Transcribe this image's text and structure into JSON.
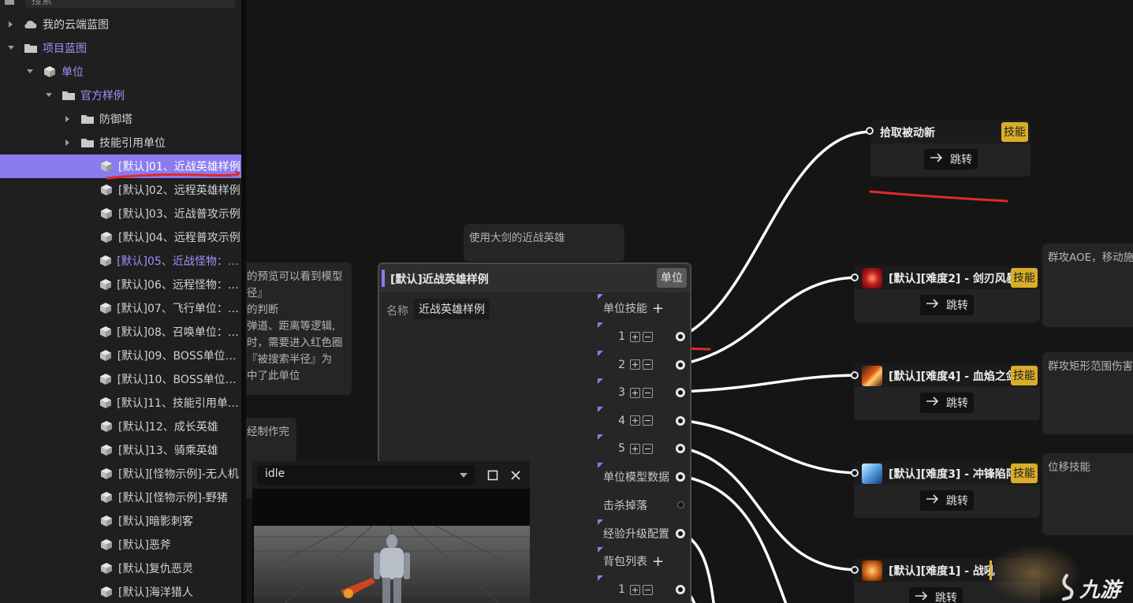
{
  "search": {
    "placeholder": "搜索"
  },
  "tree": {
    "items": [
      {
        "label": "我的云端蓝图",
        "icon": "cloud-icon",
        "expand": "collapsed"
      },
      {
        "label": "项目蓝图",
        "icon": "folder-icon",
        "expand": "expanded"
      },
      {
        "label": "单位",
        "icon": "cube-icon",
        "expand": "expanded"
      },
      {
        "label": "官方样例",
        "icon": "folder-icon",
        "expand": "expanded"
      },
      {
        "label": "防御塔",
        "icon": "folder-icon",
        "expand": "collapsed"
      },
      {
        "label": "技能引用单位",
        "icon": "folder-icon",
        "expand": "collapsed"
      },
      {
        "label": "[默认]01、近战英雄样例",
        "icon": "cube-icon",
        "expand": "none"
      },
      {
        "label": "[默认]02、远程英雄样例",
        "icon": "cube-icon",
        "expand": "none"
      },
      {
        "label": "[默认]03、近战普攻示例",
        "icon": "cube-icon",
        "expand": "none"
      },
      {
        "label": "[默认]04、远程普攻示例",
        "icon": "cube-icon",
        "expand": "none"
      },
      {
        "label": "[默认]05、近战怪物：狼人",
        "icon": "cube-icon",
        "expand": "none"
      },
      {
        "label": "[默认]06、远程怪物：爬虫",
        "icon": "cube-icon",
        "expand": "none"
      },
      {
        "label": "[默认]07、飞行单位：秃鹫",
        "icon": "cube-icon",
        "expand": "none"
      },
      {
        "label": "[默认]08、召唤单位：水...",
        "icon": "cube-icon",
        "expand": "none"
      },
      {
        "label": "[默认]09、BOSS单位：...",
        "icon": "cube-icon",
        "expand": "none"
      },
      {
        "label": "[默认]10、BOSS单位：...",
        "icon": "cube-icon",
        "expand": "none"
      },
      {
        "label": "[默认]11、技能引用单位...",
        "icon": "cube-icon",
        "expand": "none"
      },
      {
        "label": "[默认]12、成长英雄",
        "icon": "cube-icon",
        "expand": "none"
      },
      {
        "label": "[默认]13、骑乘英雄",
        "icon": "cube-icon",
        "expand": "none"
      },
      {
        "label": "[默认][怪物示例]-无人机",
        "icon": "cube-icon",
        "expand": "none"
      },
      {
        "label": "[默认][怪物示例]-野猪",
        "icon": "cube-icon",
        "expand": "none"
      },
      {
        "label": "[默认]暗影刺客",
        "icon": "cube-icon",
        "expand": "none"
      },
      {
        "label": "[默认]恶斧",
        "icon": "cube-icon",
        "expand": "none"
      },
      {
        "label": "[默认]复仇恶灵",
        "icon": "cube-icon",
        "expand": "none"
      },
      {
        "label": "[默认]海洋猎人",
        "icon": "cube-icon",
        "expand": "none"
      }
    ],
    "selected_index": 6,
    "highlight_index": 10
  },
  "comments": {
    "top": "使用大剑的近战英雄",
    "left_partial": "的预览可以看到模型\n径』\n的判断\n弹道、距离等逻辑,\n时，需要进入红色圈\n『被搜索半径』为\n中了此单位",
    "left_partial2": "经制作完",
    "skill2": "群攻AOE，移动施",
    "skill4": "群攻矩形范围伤害",
    "skill3": "位移技能"
  },
  "main_node": {
    "title": "[默认]近战英雄样例",
    "tag": "单位",
    "name_label": "名称",
    "name_value": "近战英雄样例",
    "skills_label": "单位技能",
    "skill_slots": [
      "1",
      "2",
      "3",
      "4",
      "5"
    ],
    "model_label": "单位模型数据",
    "drop_label": "击杀掉落",
    "exp_label": "经验升级配置",
    "bag_label": "背包列表",
    "bag_slots": [
      "1"
    ],
    "plus": "+",
    "minus": "−"
  },
  "skill_nodes": [
    {
      "title": "拾取被动新",
      "tag": "技能",
      "jump": "跳转",
      "icon": ""
    },
    {
      "title": "[默认][难度2] - 剑刃风暴",
      "tag": "技能",
      "jump": "跳转",
      "icon": "blade-storm-icon"
    },
    {
      "title": "[默认][难度4] - 血焰之剑",
      "tag": "技能",
      "jump": "跳转",
      "icon": "blood-flame-sword-icon"
    },
    {
      "title": "[默认][难度3] - 冲锋陷阵",
      "tag": "技能",
      "jump": "跳转",
      "icon": "charge-icon"
    },
    {
      "title": "[默认][难度1] - 战吼",
      "tag": "",
      "jump": "跳转",
      "icon": "war-cry-icon"
    }
  ],
  "preview": {
    "animation": "idle"
  },
  "colors": {
    "accent": "#8a7cf0",
    "skill_tag": "#d8ae2a",
    "annotation_red": "#e02a2a",
    "wire": "#ffffff"
  },
  "watermark": "九游"
}
